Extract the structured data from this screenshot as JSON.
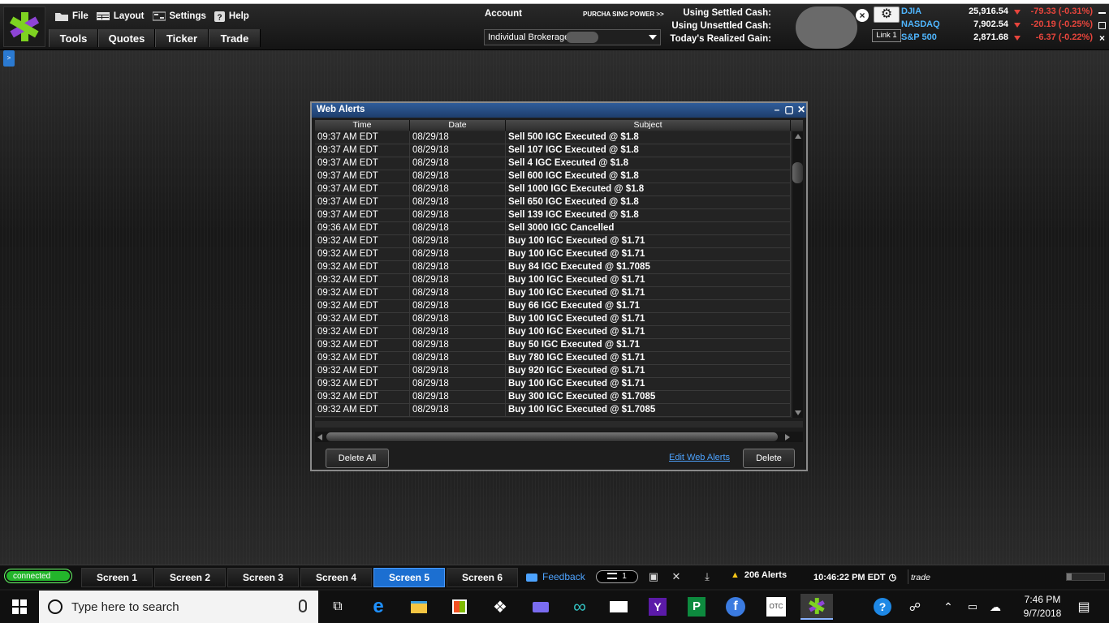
{
  "menus": {
    "row1": [
      {
        "label": "File",
        "icon": "folder-icon"
      },
      {
        "label": "Layout",
        "icon": "layout-icon"
      },
      {
        "label": "Settings",
        "icon": "settings-icon"
      },
      {
        "label": "Help",
        "icon": "help-icon"
      }
    ],
    "row2": [
      "Tools",
      "Quotes",
      "Ticker",
      "Trade"
    ]
  },
  "account": {
    "label": "Account",
    "purchasing_power": "PURCHA SING POWER >>",
    "selected": "Individual Brokerage",
    "cash_labels": [
      "Using Settled Cash:",
      "Using Unsettled Cash:",
      "Today's Realized Gain:"
    ],
    "link": "Link 1"
  },
  "indices": [
    {
      "name": "DJIA",
      "value": "25,916.54",
      "change": "-79.33 (-0.31%)"
    },
    {
      "name": "NASDAQ",
      "value": "7,902.54",
      "change": "-20.19 (-0.25%)"
    },
    {
      "name": "S&P 500",
      "value": "2,871.68",
      "change": "-6.37 (-0.22%)"
    }
  ],
  "side_tab": ">",
  "web_alerts": {
    "title": "Web Alerts",
    "columns": [
      "Time",
      "Date",
      "Subject"
    ],
    "rows": [
      [
        "09:37 AM EDT",
        "08/29/18",
        "Sell 500 IGC Executed @ $1.8"
      ],
      [
        "09:37 AM EDT",
        "08/29/18",
        "Sell 107 IGC Executed @ $1.8"
      ],
      [
        "09:37 AM EDT",
        "08/29/18",
        "Sell 4 IGC Executed @ $1.8"
      ],
      [
        "09:37 AM EDT",
        "08/29/18",
        "Sell 600 IGC Executed @ $1.8"
      ],
      [
        "09:37 AM EDT",
        "08/29/18",
        "Sell 1000 IGC Executed @ $1.8"
      ],
      [
        "09:37 AM EDT",
        "08/29/18",
        "Sell 650 IGC Executed @ $1.8"
      ],
      [
        "09:37 AM EDT",
        "08/29/18",
        "Sell 139 IGC Executed @ $1.8"
      ],
      [
        "09:36 AM EDT",
        "08/29/18",
        "Sell 3000 IGC Cancelled"
      ],
      [
        "09:32 AM EDT",
        "08/29/18",
        "Buy 100 IGC Executed @ $1.71"
      ],
      [
        "09:32 AM EDT",
        "08/29/18",
        "Buy 100 IGC Executed @ $1.71"
      ],
      [
        "09:32 AM EDT",
        "08/29/18",
        "Buy 84 IGC Executed @ $1.7085"
      ],
      [
        "09:32 AM EDT",
        "08/29/18",
        "Buy 100 IGC Executed @ $1.71"
      ],
      [
        "09:32 AM EDT",
        "08/29/18",
        "Buy 100 IGC Executed @ $1.71"
      ],
      [
        "09:32 AM EDT",
        "08/29/18",
        "Buy 66 IGC Executed @ $1.71"
      ],
      [
        "09:32 AM EDT",
        "08/29/18",
        "Buy 100 IGC Executed @ $1.71"
      ],
      [
        "09:32 AM EDT",
        "08/29/18",
        "Buy 100 IGC Executed @ $1.71"
      ],
      [
        "09:32 AM EDT",
        "08/29/18",
        "Buy 50 IGC Executed @ $1.71"
      ],
      [
        "09:32 AM EDT",
        "08/29/18",
        "Buy 780 IGC Executed @ $1.71"
      ],
      [
        "09:32 AM EDT",
        "08/29/18",
        "Buy 920 IGC Executed @ $1.71"
      ],
      [
        "09:32 AM EDT",
        "08/29/18",
        "Buy 100 IGC Executed @ $1.71"
      ],
      [
        "09:32 AM EDT",
        "08/29/18",
        "Buy 300 IGC Executed @ $1.7085"
      ],
      [
        "09:32 AM EDT",
        "08/29/18",
        "Buy 100 IGC Executed @ $1.7085"
      ]
    ],
    "delete_all": "Delete All",
    "edit_link": "Edit Web Alerts",
    "delete": "Delete"
  },
  "statusbar": {
    "connected": "connected",
    "screens": [
      "Screen 1",
      "Screen 2",
      "Screen 3",
      "Screen 4",
      "Screen 5",
      "Screen 6"
    ],
    "active_screen": "Screen 5",
    "feedback": "Feedback",
    "message_count": "1",
    "alerts": "206 Alerts",
    "clock": "10:46:22 PM EDT",
    "trade": "trade"
  },
  "taskbar": {
    "search_placeholder": "Type here to search",
    "time": "7:46 PM",
    "date": "9/7/2018",
    "apps": [
      "task-view-icon",
      "edge-icon",
      "file-explorer-icon",
      "store-icon",
      "dropbox-icon",
      "mail-envelope-icon",
      "infinity-icon",
      "mail-icon",
      "yahoo-icon",
      "publisher-icon",
      "facebook-icon",
      "otc-icon",
      "etrade-icon"
    ],
    "otc_label": "OTC",
    "yahoo_label": "Y",
    "publisher_label": "P",
    "facebook_label": "f"
  },
  "colors": {
    "accent_blue": "#1c6fd1",
    "link_blue": "#4da3ff",
    "down_red": "#e8453c",
    "connected_green": "#23b52b",
    "index_blue": "#4fb6ff"
  }
}
